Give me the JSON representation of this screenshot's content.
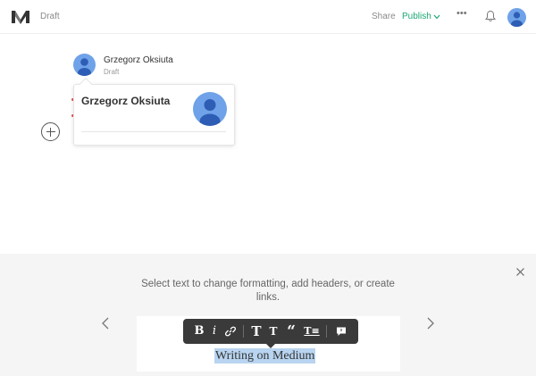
{
  "header": {
    "status": "Draft",
    "share_label": "Share",
    "publish_label": "Publish",
    "more_label": "•••",
    "accent_color": "#1aa873"
  },
  "author": {
    "name": "Grzegorz Oksiuta",
    "status": "Draft"
  },
  "popover": {
    "name": "Grzegorz Oksiuta"
  },
  "tutorial": {
    "text": "Select text to change formatting, add headers, or create links.",
    "toolbar_buttons": [
      {
        "label": "B",
        "name": "bold-button"
      },
      {
        "label": "i",
        "name": "italic-button"
      },
      {
        "label": "link-icon",
        "name": "link-button"
      },
      {
        "label": "T",
        "name": "large-heading-button"
      },
      {
        "label": "T",
        "name": "small-heading-button"
      },
      {
        "label": "“",
        "name": "quote-button"
      },
      {
        "label": "T≡",
        "name": "dropcap-button"
      },
      {
        "label": "comment-icon",
        "name": "private-note-button"
      }
    ],
    "sample_text": "Writing on Medium"
  }
}
